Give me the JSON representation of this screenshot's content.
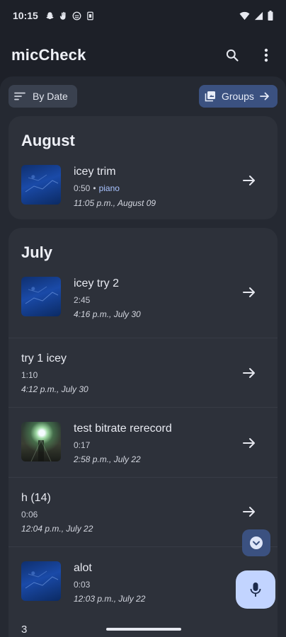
{
  "status_bar": {
    "time": "10:15"
  },
  "app_bar": {
    "title": "micCheck"
  },
  "filters": {
    "sort_label": "By Date",
    "groups_label": "Groups"
  },
  "sections": [
    {
      "month": "August",
      "items": [
        {
          "title": "icey trim",
          "duration": "0:50",
          "tag": "piano",
          "date": "11:05 p.m., August 09",
          "thumb": "sky"
        }
      ]
    },
    {
      "month": "July",
      "items": [
        {
          "title": "icey try 2",
          "duration": "2:45",
          "date": "4:16 p.m., July 30",
          "thumb": "sky"
        },
        {
          "title": "try 1 icey",
          "duration": "1:10",
          "date": "4:12 p.m., July 30",
          "thumb": ""
        },
        {
          "title": "test bitrate rerecord",
          "duration": "0:17",
          "date": "2:58 p.m., July 22",
          "thumb": "light"
        },
        {
          "title": "h (14)",
          "duration": "0:06",
          "date": "12:04 p.m., July 22",
          "thumb": ""
        },
        {
          "title": "alot",
          "duration": "0:03",
          "date": "12:03 p.m., July 22",
          "thumb": "sky"
        }
      ]
    }
  ],
  "footer": {
    "count": "3"
  },
  "colors": {
    "background": "#1d2028",
    "card": "#2d313a",
    "accent": "#3b5180",
    "fab": "#c2d4ff",
    "tag": "#a9c3ff"
  },
  "icons": [
    "search-icon",
    "more-vert-icon",
    "sort-icon",
    "groups-icon",
    "arrow-forward-icon",
    "chevron-down-icon",
    "mic-icon"
  ]
}
